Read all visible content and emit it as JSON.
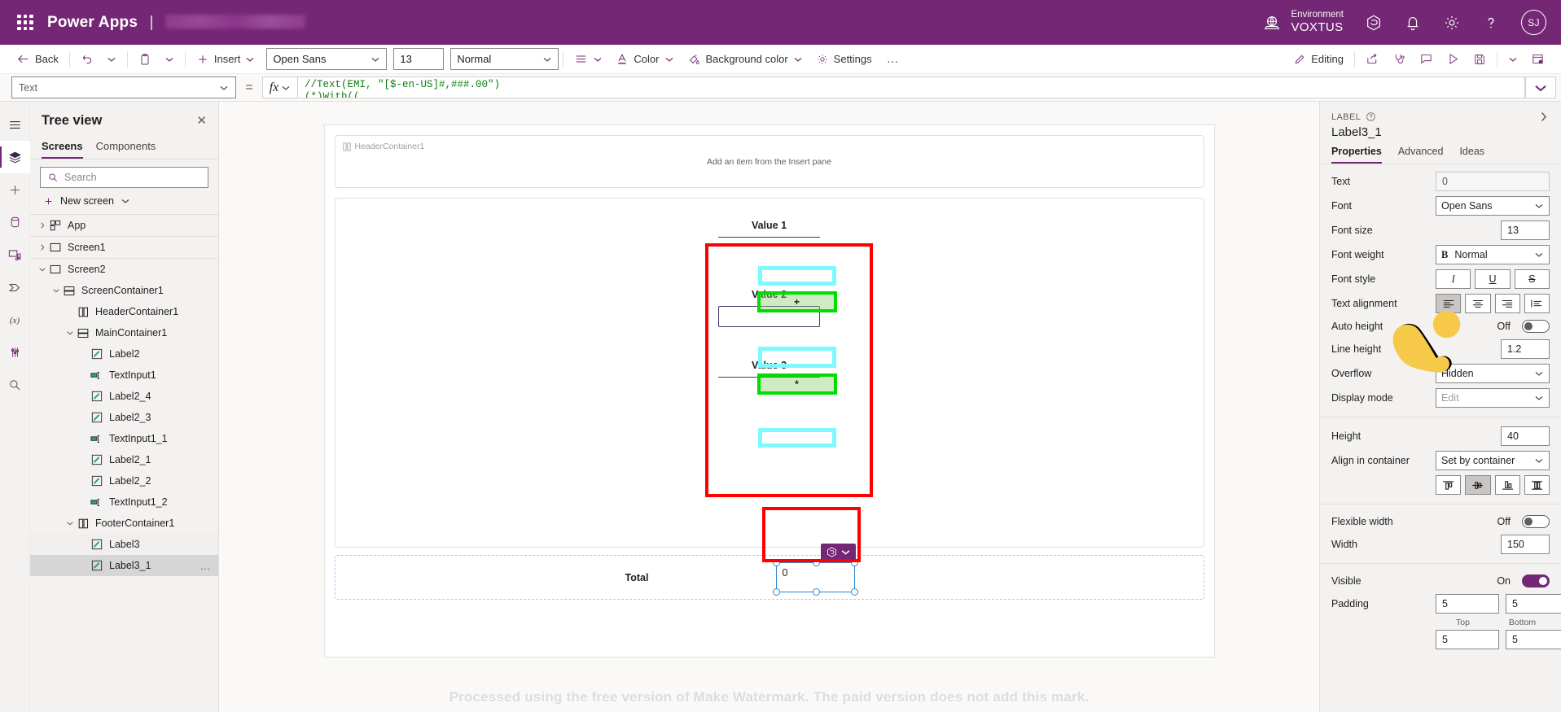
{
  "topbar": {
    "waffle_icon": "waffle-icon",
    "brand": "Power Apps",
    "separator": "|",
    "app_name": "",
    "environment_label": "Environment",
    "environment_value": "VOXTUS",
    "globe_icon": "globe-icon",
    "icons": [
      "copilot-icon",
      "bell-icon",
      "gear-icon",
      "help-icon"
    ],
    "avatar_initials": "SJ",
    "bg_color": "#742774"
  },
  "commandbar": {
    "back": "Back",
    "undo_icon": "undo-icon",
    "undo_caret": "chevron-down-icon",
    "paste_icon": "paste-icon",
    "paste_caret": "chevron-down-icon",
    "insert": "Insert",
    "font": "Open Sans",
    "font_size": "13",
    "font_weight": "Normal",
    "align_icon": "text-align-icon",
    "color": "Color",
    "background_color": "Background color",
    "settings": "Settings",
    "overflow": "…",
    "editing": "Editing",
    "right_icons": [
      "share-icon",
      "test-icon",
      "comment-icon",
      "play-icon",
      "save-icon",
      "chevron-down-icon",
      "publish-icon"
    ]
  },
  "formulabar": {
    "property": "Text",
    "equals": "=",
    "fx": "fx",
    "formula_line1": "//Text(EMI, \"[$-en-US]#,###.00\")",
    "formula_line2": "(*)With((",
    "expand_icon": "chevron-down-icon"
  },
  "rail": {
    "items": [
      {
        "name": "hamburger-icon",
        "active": false
      },
      {
        "name": "tree-view-icon",
        "active": true
      },
      {
        "name": "insert-plus-icon",
        "active": false
      },
      {
        "name": "data-icon",
        "active": false
      },
      {
        "name": "media-icon",
        "active": false
      },
      {
        "name": "power-automate-icon",
        "active": false
      },
      {
        "name": "variables-icon",
        "active": false
      },
      {
        "name": "tools-icon",
        "active": false
      },
      {
        "name": "search-icon",
        "active": false
      }
    ]
  },
  "treeview": {
    "title": "Tree view",
    "close_icon": "close-icon",
    "tabs": [
      {
        "label": "Screens",
        "active": true
      },
      {
        "label": "Components",
        "active": false
      }
    ],
    "search_placeholder": "Search",
    "search_icon": "search-icon",
    "new_screen": "New screen",
    "new_screen_icon": "plus-icon",
    "new_screen_caret": "chevron-down-icon",
    "nodes": [
      {
        "label": "App",
        "indent": 0,
        "chevron": "right",
        "icon": "app-icon",
        "state": "",
        "divider_after": true
      },
      {
        "label": "Screen1",
        "indent": 0,
        "chevron": "right",
        "icon": "screen-icon",
        "state": "",
        "divider_after": true
      },
      {
        "label": "Screen2",
        "indent": 0,
        "chevron": "down",
        "icon": "screen-icon",
        "state": ""
      },
      {
        "label": "ScreenContainer1",
        "indent": 1,
        "chevron": "down",
        "icon": "vertical-container-icon",
        "state": ""
      },
      {
        "label": "HeaderContainer1",
        "indent": 2,
        "chevron": "none",
        "icon": "horizontal-container-icon",
        "state": ""
      },
      {
        "label": "MainContainer1",
        "indent": 2,
        "chevron": "down",
        "icon": "vertical-container-icon",
        "state": ""
      },
      {
        "label": "Label2",
        "indent": 3,
        "chevron": "none",
        "icon": "label-icon",
        "state": ""
      },
      {
        "label": "TextInput1",
        "indent": 3,
        "chevron": "none",
        "icon": "textinput-icon",
        "state": ""
      },
      {
        "label": "Label2_4",
        "indent": 3,
        "chevron": "none",
        "icon": "label-icon",
        "state": ""
      },
      {
        "label": "Label2_3",
        "indent": 3,
        "chevron": "none",
        "icon": "label-icon",
        "state": ""
      },
      {
        "label": "TextInput1_1",
        "indent": 3,
        "chevron": "none",
        "icon": "textinput-icon",
        "state": ""
      },
      {
        "label": "Label2_1",
        "indent": 3,
        "chevron": "none",
        "icon": "label-icon",
        "state": ""
      },
      {
        "label": "Label2_2",
        "indent": 3,
        "chevron": "none",
        "icon": "label-icon",
        "state": ""
      },
      {
        "label": "TextInput1_2",
        "indent": 3,
        "chevron": "none",
        "icon": "textinput-icon",
        "state": ""
      },
      {
        "label": "FooterContainer1",
        "indent": 2,
        "chevron": "down",
        "icon": "horizontal-container-icon",
        "state": ""
      },
      {
        "label": "Label3",
        "indent": 3,
        "chevron": "none",
        "icon": "label-icon",
        "state": "hl"
      },
      {
        "label": "Label3_1",
        "indent": 3,
        "chevron": "none",
        "icon": "label-icon",
        "state": "selected",
        "more": "…"
      }
    ]
  },
  "canvas": {
    "header_container_tag": "HeaderContainer1",
    "header_hint": "Add an item from the Insert pane",
    "fields": [
      {
        "label": "Value 1",
        "input_value": "",
        "op": "+"
      },
      {
        "label": "Value 2",
        "input_value": "",
        "op": "*"
      },
      {
        "label": "Value 3",
        "input_value": "",
        "op": ""
      }
    ],
    "total_label": "Total",
    "total_value": "0",
    "selection_badge_icon": "component-icon",
    "selection_badge_caret": "chevron-down-icon",
    "watermark": "Processed using the free version of Make Watermark. The paid version does not add this mark.",
    "annotation_red": "#ff0000",
    "annotation_cyan": "#7df9ff",
    "annotation_green": "#00dd00"
  },
  "properties": {
    "kicker": "LABEL",
    "help_icon": "help-circle-icon",
    "collapse_icon": "chevron-right-icon",
    "name": "Label3_1",
    "tabs": [
      {
        "label": "Properties",
        "active": true
      },
      {
        "label": "Advanced",
        "active": false
      },
      {
        "label": "Ideas",
        "active": false
      }
    ],
    "text_label": "Text",
    "text_value": "0",
    "font_label": "Font",
    "font_value": "Open Sans",
    "font_size_label": "Font size",
    "font_size_value": "13",
    "font_weight_label": "Font weight",
    "font_weight_value": "Normal",
    "font_weight_glyph": "B",
    "font_style_label": "Font style",
    "font_style_italic": "I",
    "font_style_underline": "U",
    "font_style_strike": "S",
    "text_alignment_label": "Text alignment",
    "align_options": [
      "align-left-icon",
      "align-center-icon",
      "align-right-icon",
      "align-justify-icon"
    ],
    "auto_height_label": "Auto height",
    "auto_height_state": "Off",
    "line_height_label": "Line height",
    "line_height_value": "1.2",
    "overflow_label": "Overflow",
    "overflow_value": "Hidden",
    "display_mode_label": "Display mode",
    "display_mode_value": "Edit",
    "height_label": "Height",
    "height_value": "40",
    "align_container_label": "Align in container",
    "align_container_value": "Set by container",
    "container_align_options": [
      "align-top-icon",
      "align-middle-icon",
      "align-bottom-icon",
      "align-stretch-icon"
    ],
    "flexible_width_label": "Flexible width",
    "flexible_width_state": "Off",
    "width_label": "Width",
    "width_value": "150",
    "visible_label": "Visible",
    "visible_state": "On",
    "padding_label": "Padding",
    "padding_top": "5",
    "padding_bottom": "5",
    "padding_left": "5",
    "padding_right": "5",
    "padding_cap_top": "Top",
    "padding_cap_bottom": "Bottom"
  }
}
